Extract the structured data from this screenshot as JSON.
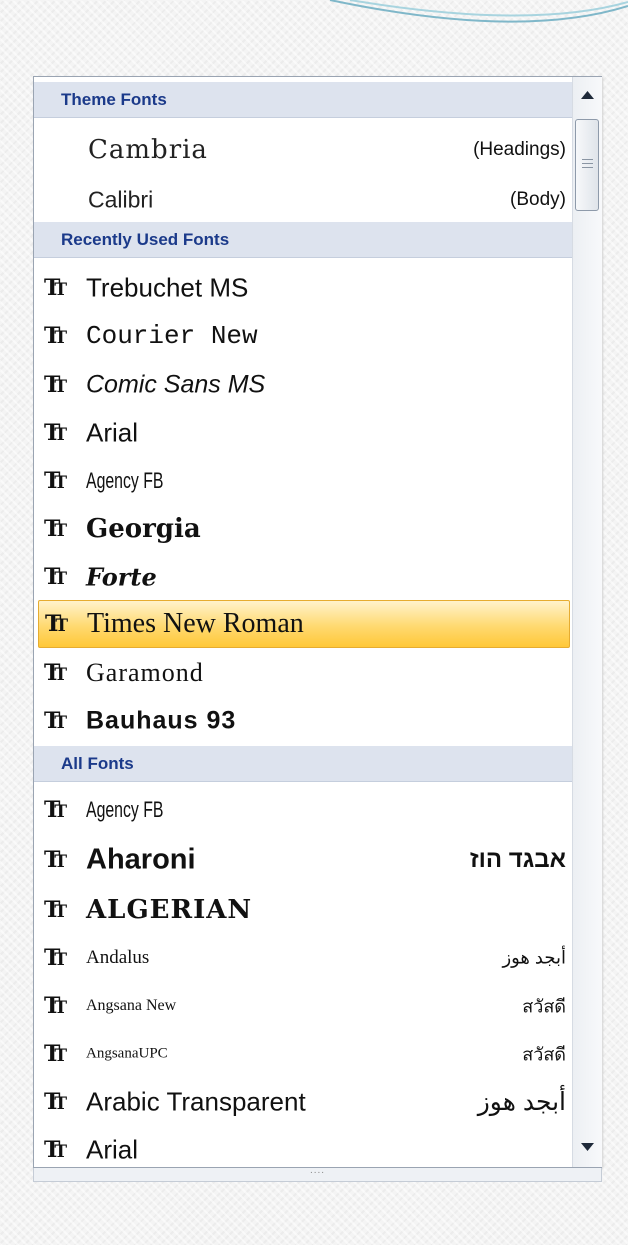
{
  "sections": {
    "theme_fonts": "Theme Fonts",
    "recent_fonts": "Recently Used Fonts",
    "all_fonts": "All Fonts"
  },
  "theme_fonts": [
    {
      "name": "Cambria",
      "role": "(Headings)"
    },
    {
      "name": "Calibri",
      "role": "(Body)"
    }
  ],
  "recent_fonts": [
    {
      "name": "Trebuchet MS"
    },
    {
      "name": "Courier New"
    },
    {
      "name": "Comic Sans MS"
    },
    {
      "name": "Arial"
    },
    {
      "name": "Agency FB"
    },
    {
      "name": "Georgia"
    },
    {
      "name": "Forte"
    },
    {
      "name": "Times New Roman",
      "selected": true
    },
    {
      "name": "Garamond"
    },
    {
      "name": "Bauhaus 93"
    }
  ],
  "all_fonts": [
    {
      "name": "Agency FB",
      "sample": ""
    },
    {
      "name": "Aharoni",
      "sample": "אבגד הוז"
    },
    {
      "name": "ALGERIAN",
      "sample": ""
    },
    {
      "name": "Andalus",
      "sample": "أبجد هوز"
    },
    {
      "name": "Angsana New",
      "sample": "สวัสดี"
    },
    {
      "name": "AngsanaUPC",
      "sample": "สวัสดี"
    },
    {
      "name": "Arabic Transparent",
      "sample": "أبجد هوز"
    },
    {
      "name": "Arial",
      "sample": ""
    }
  ],
  "icons": {
    "truetype": "truetype-font-icon",
    "scroll_up": "scroll-up-arrow-icon",
    "scroll_down": "scroll-down-arrow-icon",
    "resize": "resize-grip-icon"
  },
  "resize_grip_text": "....",
  "colors": {
    "header_bg": "#dde3ee",
    "header_text": "#1b3a8a",
    "selection": "#ffd970"
  }
}
